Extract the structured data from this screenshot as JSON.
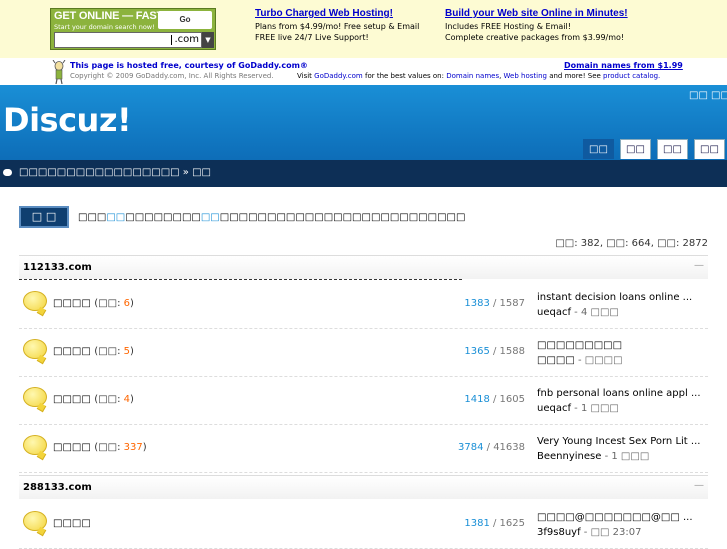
{
  "ad": {
    "godaddy_title": "GET ONLINE — FAST!",
    "godaddy_sub": "Start your domain search now!",
    "godaddy_logo": "Go Daddy.com",
    "godaddy_tld": ".com",
    "block1": {
      "heading": "Turbo Charged Web Hosting!",
      "line1": "Plans from $4.99/mo! Free setup & Email",
      "line2": "FREE live 24/7 Live Support!"
    },
    "block2": {
      "heading": "Build your Web site Online in Minutes!",
      "line1": "Includes FREE Hosting & Email!",
      "line2": "Complete creative packages from $3.99/mo!"
    }
  },
  "hosted": {
    "line1_prefix": "This page is hosted free, courtesy of ",
    "line1_link": "GoDaddy.com®",
    "copyright": "Copyright © 2009 GoDaddy.com, Inc. All Rights Reserved.",
    "right_heading": "Domain names from $1.99",
    "right_visit": "Visit ",
    "right_link1": "GoDaddy.com",
    "right_mid": " for the best values on: ",
    "right_link2": "Domain names",
    "right_link3": "Web hosting",
    "right_more": " and more! See ",
    "right_link4": "product catalog."
  },
  "header": {
    "logo": "Discuz!",
    "toplinks": [
      "□□",
      "□□"
    ],
    "tabs": [
      "□□",
      "□□",
      "□□",
      "□□"
    ]
  },
  "nav": {
    "breadcrumb": "□□□□□□□□□□□□□□□□□ » □□"
  },
  "main": {
    "login_button": "□ □",
    "welcome_a": "□□□",
    "welcome_hl1": "□□",
    "welcome_b": "□□□□□□□□",
    "welcome_hl2": "□□",
    "welcome_c": "□□□□□□□□□□□□□□□□□□□□□□□□□□",
    "stats": "□□: 382, □□: 664, □□: 2872"
  },
  "sections": [
    {
      "title": "112133.com",
      "collapse": "—",
      "forums": [
        {
          "name": "□□□□",
          "today_label": "□□",
          "today": "6",
          "threads": "1383",
          "posts": "1587",
          "last_title": "instant decision loans online ...",
          "last_author": "ueqacf",
          "last_when": "4 □□□"
        },
        {
          "name": "□□□□",
          "today_label": "□□",
          "today": "5",
          "threads": "1365",
          "posts": "1588",
          "last_title": "□□□□□□□□□",
          "last_author": "□□□□",
          "last_when": "□□□□"
        },
        {
          "name": "□□□□",
          "today_label": "□□",
          "today": "4",
          "threads": "1418",
          "posts": "1605",
          "last_title": "fnb personal loans online appl ...",
          "last_author": "ueqacf",
          "last_when": "1 □□□"
        },
        {
          "name": "□□□□",
          "today_label": "□□",
          "today": "337",
          "threads": "3784",
          "posts": "41638",
          "last_title": "Very Young Incest Sex Porn Lit ...",
          "last_author": "Beennyinese",
          "last_when": "1 □□□"
        }
      ]
    },
    {
      "title": "288133.com",
      "collapse": "—",
      "forums": [
        {
          "name": "□□□□",
          "today_label": "",
          "today": "",
          "threads": "1381",
          "posts": "1625",
          "last_title": "□□□□@□□□□□□□@□□ ...",
          "last_author": "3f9s8uyf",
          "last_when": "□□ 23:07"
        }
      ]
    }
  ]
}
